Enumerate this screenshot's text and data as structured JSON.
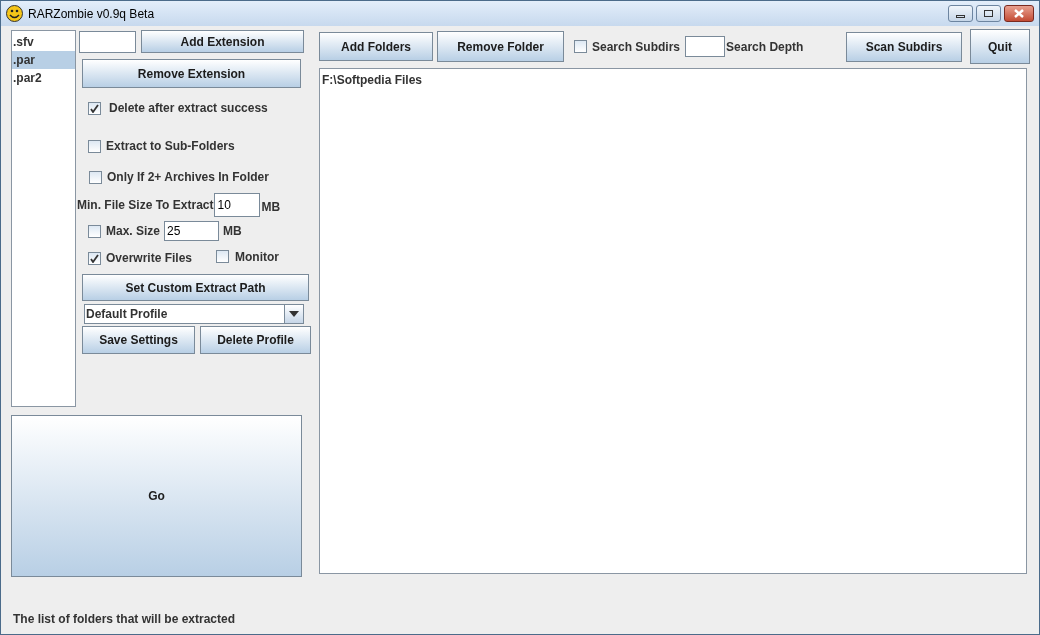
{
  "window": {
    "title": "RARZombie v0.9q Beta"
  },
  "extensions": [
    {
      "label": ".sfv",
      "selected": false
    },
    {
      "label": ".par",
      "selected": true
    },
    {
      "label": ".par2",
      "selected": false
    }
  ],
  "add_extension": "Add Extension",
  "remove_extension": "Remove Extension",
  "delete_after": {
    "label": "Delete after extract success",
    "checked": true
  },
  "extract_sub": {
    "label": "Extract to Sub-Folders",
    "checked": false
  },
  "only_if": {
    "label": "Only If 2+ Archives In Folder",
    "checked": false
  },
  "min_size": {
    "label": "Min. File Size To Extract",
    "value": "10",
    "unit": "MB"
  },
  "max_size": {
    "label": "Max. Size",
    "checked": false,
    "value": "25",
    "unit": "MB"
  },
  "overwrite": {
    "label": "Overwrite Files",
    "checked": true
  },
  "monitor": {
    "label": "Monitor",
    "checked": false
  },
  "custom_path": "Set Custom Extract Path",
  "profile": {
    "value": "Default Profile"
  },
  "save_settings": "Save Settings",
  "delete_profile": "Delete Profile",
  "go": "Go",
  "add_folders": "Add Folders",
  "remove_folder": "Remove Folder",
  "search_subdirs": {
    "label": "Search Subdirs",
    "checked": false
  },
  "search_depth": {
    "label": "Search Depth"
  },
  "scan_subdirs": "Scan Subdirs",
  "quit": "Quit",
  "folders": [
    "F:\\Softpedia Files"
  ],
  "status": "The list of folders that will be extracted"
}
